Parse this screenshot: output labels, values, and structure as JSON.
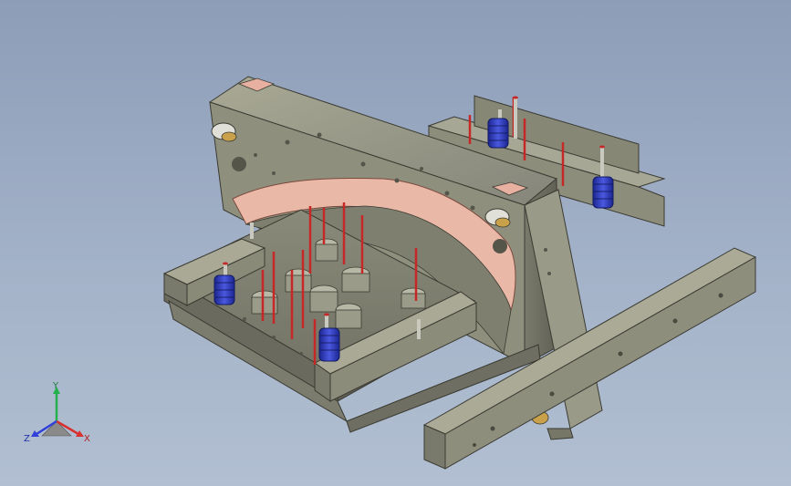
{
  "viewport": {
    "background_top": "#8d9db8",
    "background_bottom": "#b2bfd2"
  },
  "model": {
    "plate_color": "#9c9c88",
    "plate_shadow": "#6f6f60",
    "cavity_color": "#eab8a6",
    "pin_color": "#c62828",
    "spring_color": "#2a36b8",
    "ejector_color": "#d6d6d0"
  },
  "triad": {
    "x_label": "X",
    "y_label": "Y",
    "z_label": "Z",
    "x_color": "#d93030",
    "y_color": "#22b14c",
    "z_color": "#3040d8"
  }
}
